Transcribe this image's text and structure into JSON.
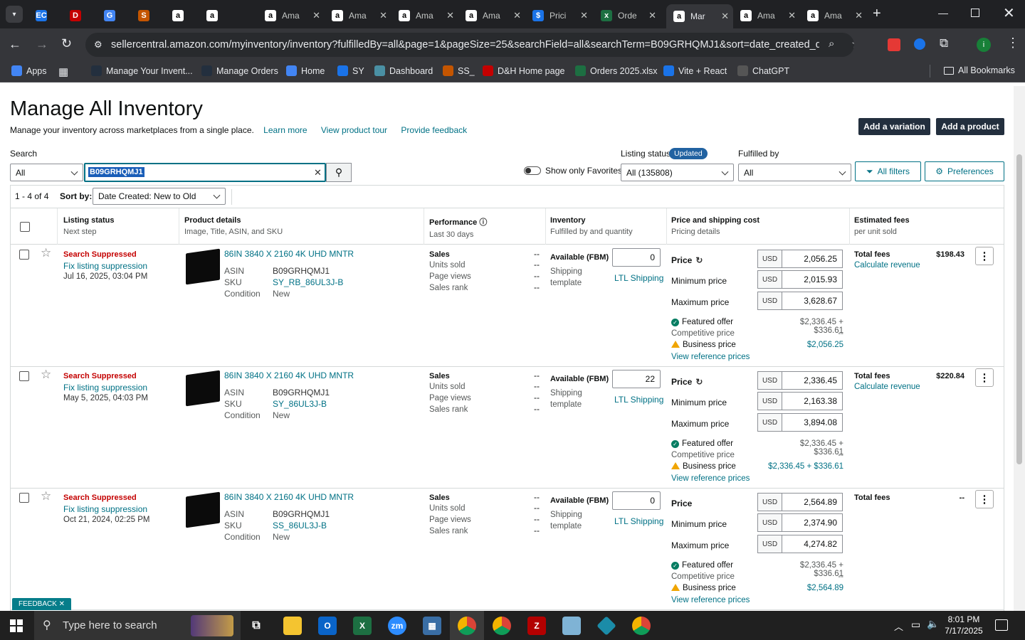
{
  "browser": {
    "tabs": [
      {
        "label": "",
        "fav": "EC",
        "color": "#1a73e8"
      },
      {
        "label": "",
        "fav": "D",
        "color": "#c40000"
      },
      {
        "label": "",
        "fav": "G",
        "color": "#4285f4"
      },
      {
        "label": "",
        "fav": "S",
        "color": "#c45500"
      },
      {
        "label": "",
        "fav": "a",
        "color": "#fff"
      },
      {
        "label": "",
        "fav": "a",
        "color": "#fff"
      },
      {
        "label": "Ama",
        "fav": "a",
        "color": "#fff"
      },
      {
        "label": "Ama",
        "fav": "a",
        "color": "#fff"
      },
      {
        "label": "Ama",
        "fav": "a",
        "color": "#fff"
      },
      {
        "label": "Ama",
        "fav": "a",
        "color": "#fff"
      },
      {
        "label": "Prici",
        "fav": "$",
        "color": "#1a73e8"
      },
      {
        "label": "Orde",
        "fav": "x",
        "color": "#1d6f42"
      },
      {
        "label": "Mar",
        "fav": "a",
        "color": "#fff"
      },
      {
        "label": "Ama",
        "fav": "a",
        "color": "#fff"
      },
      {
        "label": "Ama",
        "fav": "a",
        "color": "#fff"
      }
    ],
    "url": "sellercentral.amazon.com/myinventory/inventory?fulfilledBy=all&page=1&pageSize=25&searchField=all&searchTerm=B09GRHQMJ1&sort=date_created_desc...",
    "bookmarks": [
      "Apps",
      "Manage Your Invent...",
      "Manage Orders",
      "Home",
      "SY",
      "Dashboard",
      "SS_",
      "D&H Home page",
      "Orders 2025.xlsx",
      "Vite + React",
      "ChatGPT"
    ],
    "all_bookmarks": "All Bookmarks"
  },
  "header": {
    "title": "Manage All Inventory",
    "subtitle": "Manage your inventory across marketplaces from a single place.",
    "learn_more": "Learn more",
    "tour": "View product tour",
    "feedback": "Provide feedback",
    "add_variation": "Add a variation",
    "add_product": "Add a product"
  },
  "search": {
    "label": "Search",
    "scope": "All",
    "term": "B09GRHQMJ1",
    "favorites": "Show only Favorites",
    "listing_status_label": "Listing status",
    "updated_badge": "Updated",
    "listing_status_value": "All (135808)",
    "fulfilled_label": "Fulfilled by",
    "fulfilled_value": "All",
    "all_filters": "All filters",
    "preferences": "Preferences"
  },
  "results": {
    "count": "1 - 4 of 4",
    "sort_label": "Sort by:",
    "sort_value": "Date Created: New to Old"
  },
  "columns": [
    {
      "title": "Listing status",
      "sub": "Next step"
    },
    {
      "title": "Product details",
      "sub": "Image, Title, ASIN, and SKU"
    },
    {
      "title": "Performance",
      "sub": "Last 30 days"
    },
    {
      "title": "Inventory",
      "sub": "Fulfilled by and quantity"
    },
    {
      "title": "Price and shipping cost",
      "sub": "Pricing details"
    },
    {
      "title": "Estimated fees",
      "sub": "per unit sold"
    }
  ],
  "labels": {
    "asin": "ASIN",
    "sku": "SKU",
    "condition": "Condition",
    "sales": "Sales",
    "units": "Units sold",
    "views": "Page views",
    "rank": "Sales rank",
    "dash": "--",
    "available": "Available (FBM)",
    "shipping": "Shipping",
    "template": "template",
    "price": "Price",
    "min": "Minimum price",
    "max": "Maximum price",
    "usd": "USD",
    "featured": "Featured offer",
    "competitive": "Competitive price",
    "business": "Business price",
    "ref": "View reference prices",
    "total_fees": "Total fees",
    "calc": "Calculate revenue"
  },
  "rows": [
    {
      "status": "Search Suppressed",
      "next": "Fix listing suppression",
      "date": "Jul 16, 2025, 03:04 PM",
      "title": "86IN 3840 X 2160 4K UHD MNTR",
      "asin": "B09GRHQMJ1",
      "sku": "SY_RB_86UL3J-B",
      "condition": "New",
      "qty": "0",
      "ship": "LTL Shipping",
      "price": "2,056.25",
      "min": "2,015.93",
      "max": "3,628.67",
      "featured": "$2,336.45 + $336.61",
      "competitive": "--",
      "business": "$2,056.25",
      "fees": "$198.43",
      "calc": true,
      "refresh": true
    },
    {
      "status": "Search Suppressed",
      "next": "Fix listing suppression",
      "date": "May 5, 2025, 04:03 PM",
      "title": "86IN 3840 X 2160 4K UHD MNTR",
      "asin": "B09GRHQMJ1",
      "sku": "SY_86UL3J-B",
      "condition": "New",
      "qty": "22",
      "ship": "LTL Shipping",
      "price": "2,336.45",
      "min": "2,163.38",
      "max": "3,894.08",
      "featured": "$2,336.45 + $336.61",
      "competitive": "--",
      "business": "$2,336.45 + $336.61",
      "fees": "$220.84",
      "calc": true,
      "refresh": true
    },
    {
      "status": "Search Suppressed",
      "next": "Fix listing suppression",
      "date": "Oct 21, 2024, 02:25 PM",
      "title": "86IN 3840 X 2160 4K UHD MNTR",
      "asin": "B09GRHQMJ1",
      "sku": "SS_86UL3J-B",
      "condition": "New",
      "qty": "0",
      "ship": "LTL Shipping",
      "price": "2,564.89",
      "min": "2,374.90",
      "max": "4,274.82",
      "featured": "$2,336.45 + $336.61",
      "competitive": "--",
      "business": "$2,564.89",
      "fees": "--",
      "calc": false,
      "refresh": false
    }
  ],
  "feedback_tab": "FEEDBACK",
  "taskbar": {
    "search_placeholder": "Type here to search",
    "time": "8:01 PM",
    "date": "7/17/2025"
  }
}
